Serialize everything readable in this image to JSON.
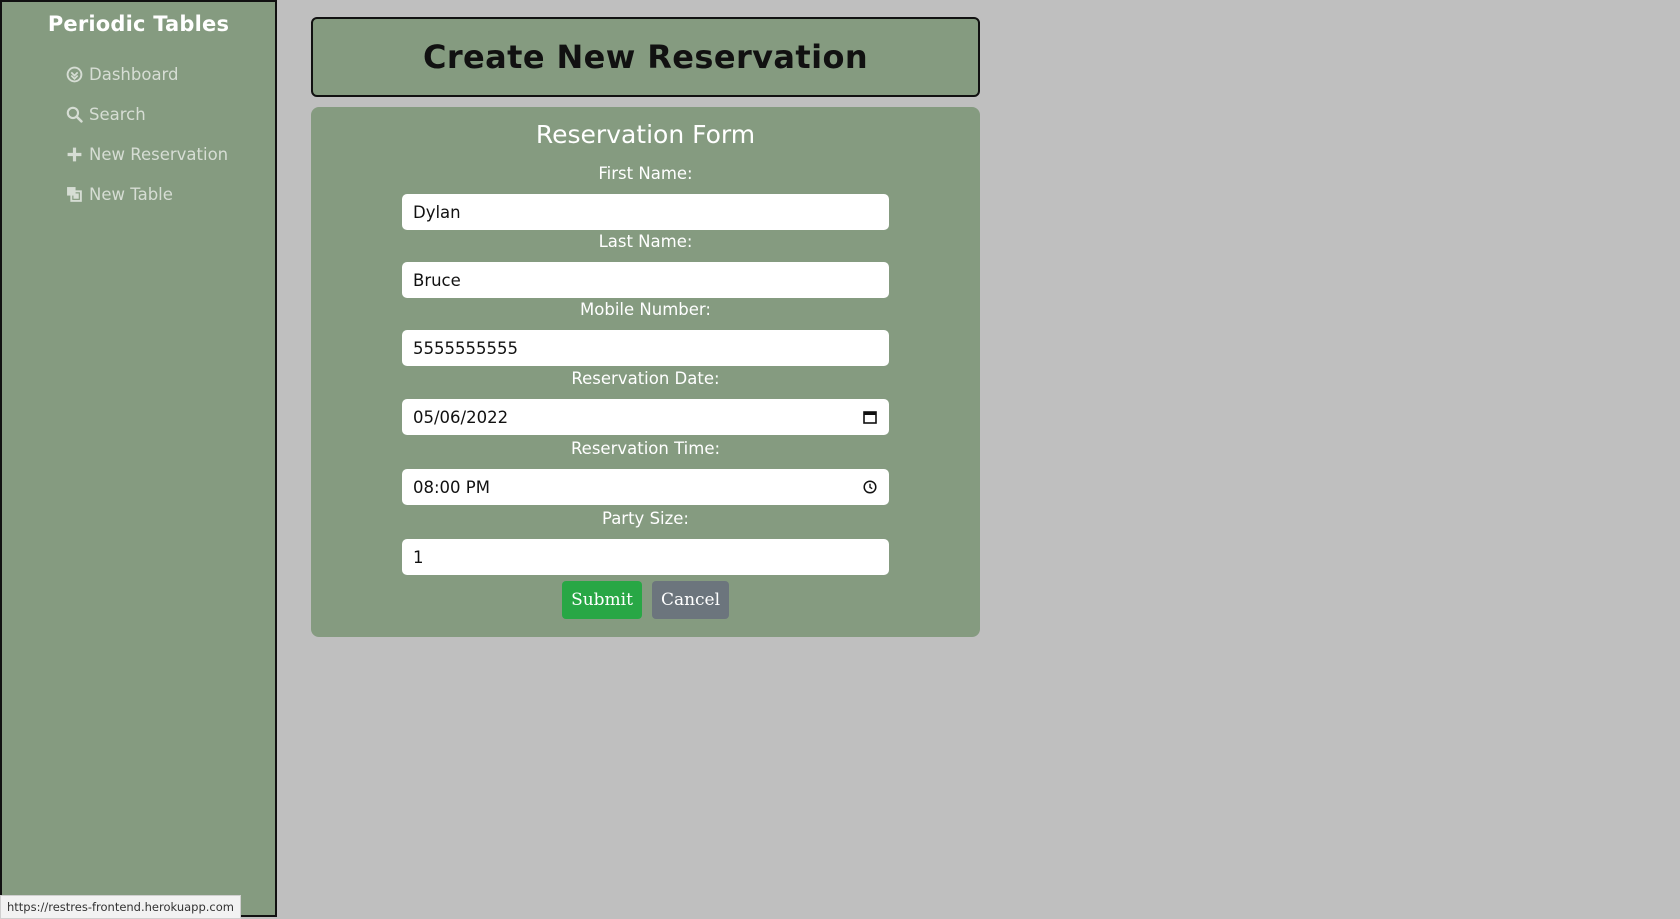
{
  "sidebar": {
    "brand": "Periodic Tables",
    "items": [
      {
        "label": "Dashboard",
        "icon": "dashboard-icon"
      },
      {
        "label": "Search",
        "icon": "search-icon"
      },
      {
        "label": "New Reservation",
        "icon": "plus-icon"
      },
      {
        "label": "New Table",
        "icon": "layers-icon"
      }
    ]
  },
  "header": {
    "title": "Create New Reservation"
  },
  "form": {
    "title": "Reservation Form",
    "fields": [
      {
        "label": "First Name:",
        "value": "Dylan"
      },
      {
        "label": "Last Name:",
        "value": "Bruce"
      },
      {
        "label": "Mobile Number:",
        "value": "5555555555"
      },
      {
        "label": "Reservation Date:",
        "value": "05/06/2022",
        "icon": "calendar-icon"
      },
      {
        "label": "Reservation Time:",
        "value": "08:00 PM",
        "icon": "clock-icon"
      },
      {
        "label": "Party Size:",
        "value": "1"
      }
    ],
    "submit_label": "Submit",
    "cancel_label": "Cancel"
  },
  "status_bar": {
    "url": "https://restres-frontend.herokuapp.com"
  },
  "colors": {
    "page_bg": "#bfbfbf",
    "panel_green": "#859b80",
    "submit_green": "#28a745",
    "cancel_gray": "#6c757d"
  }
}
